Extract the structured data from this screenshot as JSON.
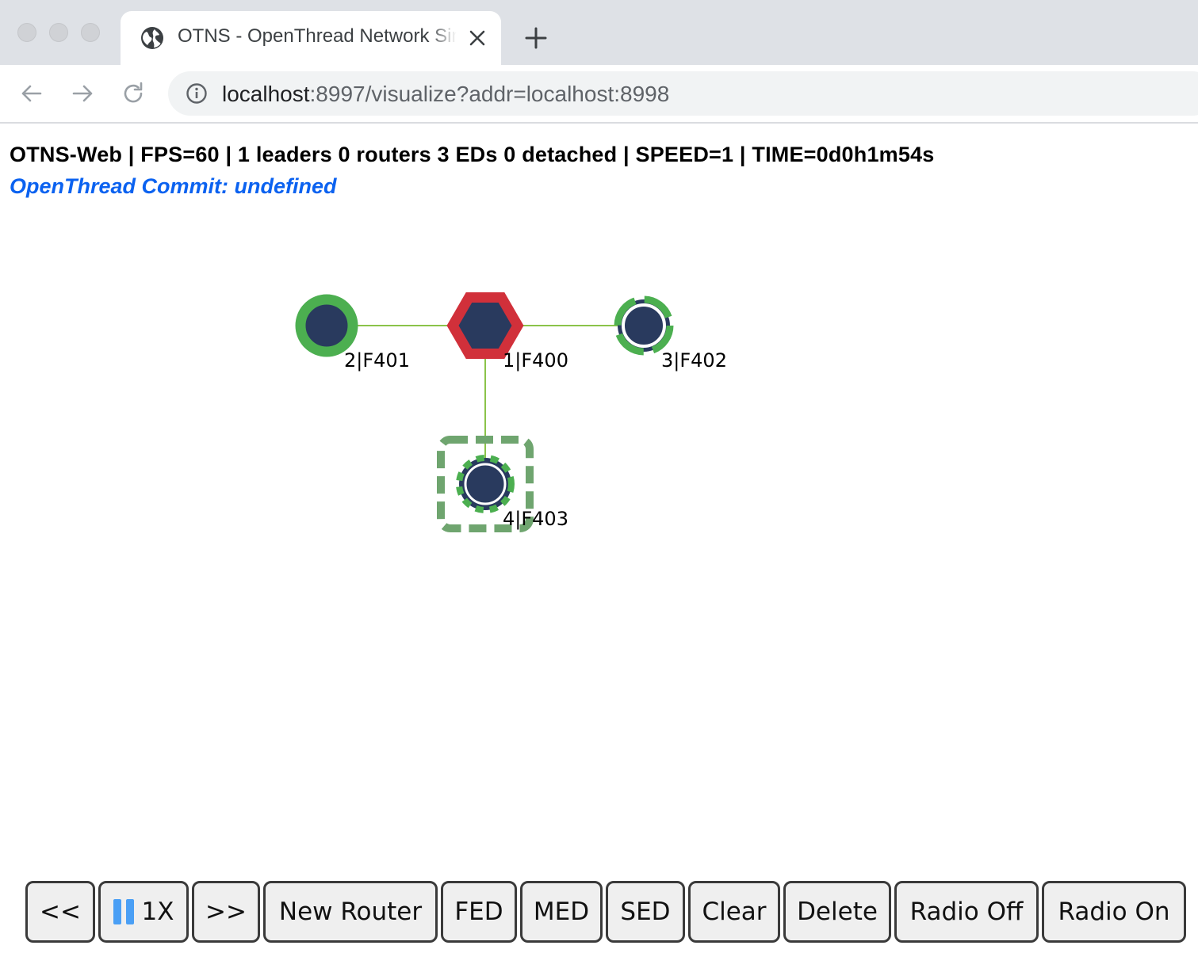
{
  "browser": {
    "tab_title": "OTNS - OpenThread Network Simulator",
    "url_host": "localhost",
    "url_rest": ":8997/visualize?addr=localhost:8998"
  },
  "status": {
    "line": "OTNS-Web | FPS=60 | 1 leaders 0 routers 3 EDs 0 detached | SPEED=1 | TIME=0d0h1m54s",
    "commit": "OpenThread Commit: undefined"
  },
  "nodes": [
    {
      "id": "1",
      "label": "1|F400",
      "role": "leader"
    },
    {
      "id": "2",
      "label": "2|F401",
      "role": "fed"
    },
    {
      "id": "3",
      "label": "3|F402",
      "role": "med"
    },
    {
      "id": "4",
      "label": "4|F403",
      "role": "sed"
    }
  ],
  "links": [
    {
      "from": "1",
      "to": "2"
    },
    {
      "from": "1",
      "to": "3"
    },
    {
      "from": "1",
      "to": "4"
    }
  ],
  "colors": {
    "node_fill": "#293a5e",
    "leader_ring": "#d1303a",
    "child_ring": "#4caf50",
    "sed_box": "#6fa56f",
    "link": "#8bc34a",
    "accent": "#0b62f0"
  },
  "controls": {
    "back": "<<",
    "speed": "1X",
    "forward": ">>",
    "new_router": "New Router",
    "fed": "FED",
    "med": "MED",
    "sed": "SED",
    "clear": "Clear",
    "delete": "Delete",
    "radio_off": "Radio Off",
    "radio_on": "Radio On"
  }
}
